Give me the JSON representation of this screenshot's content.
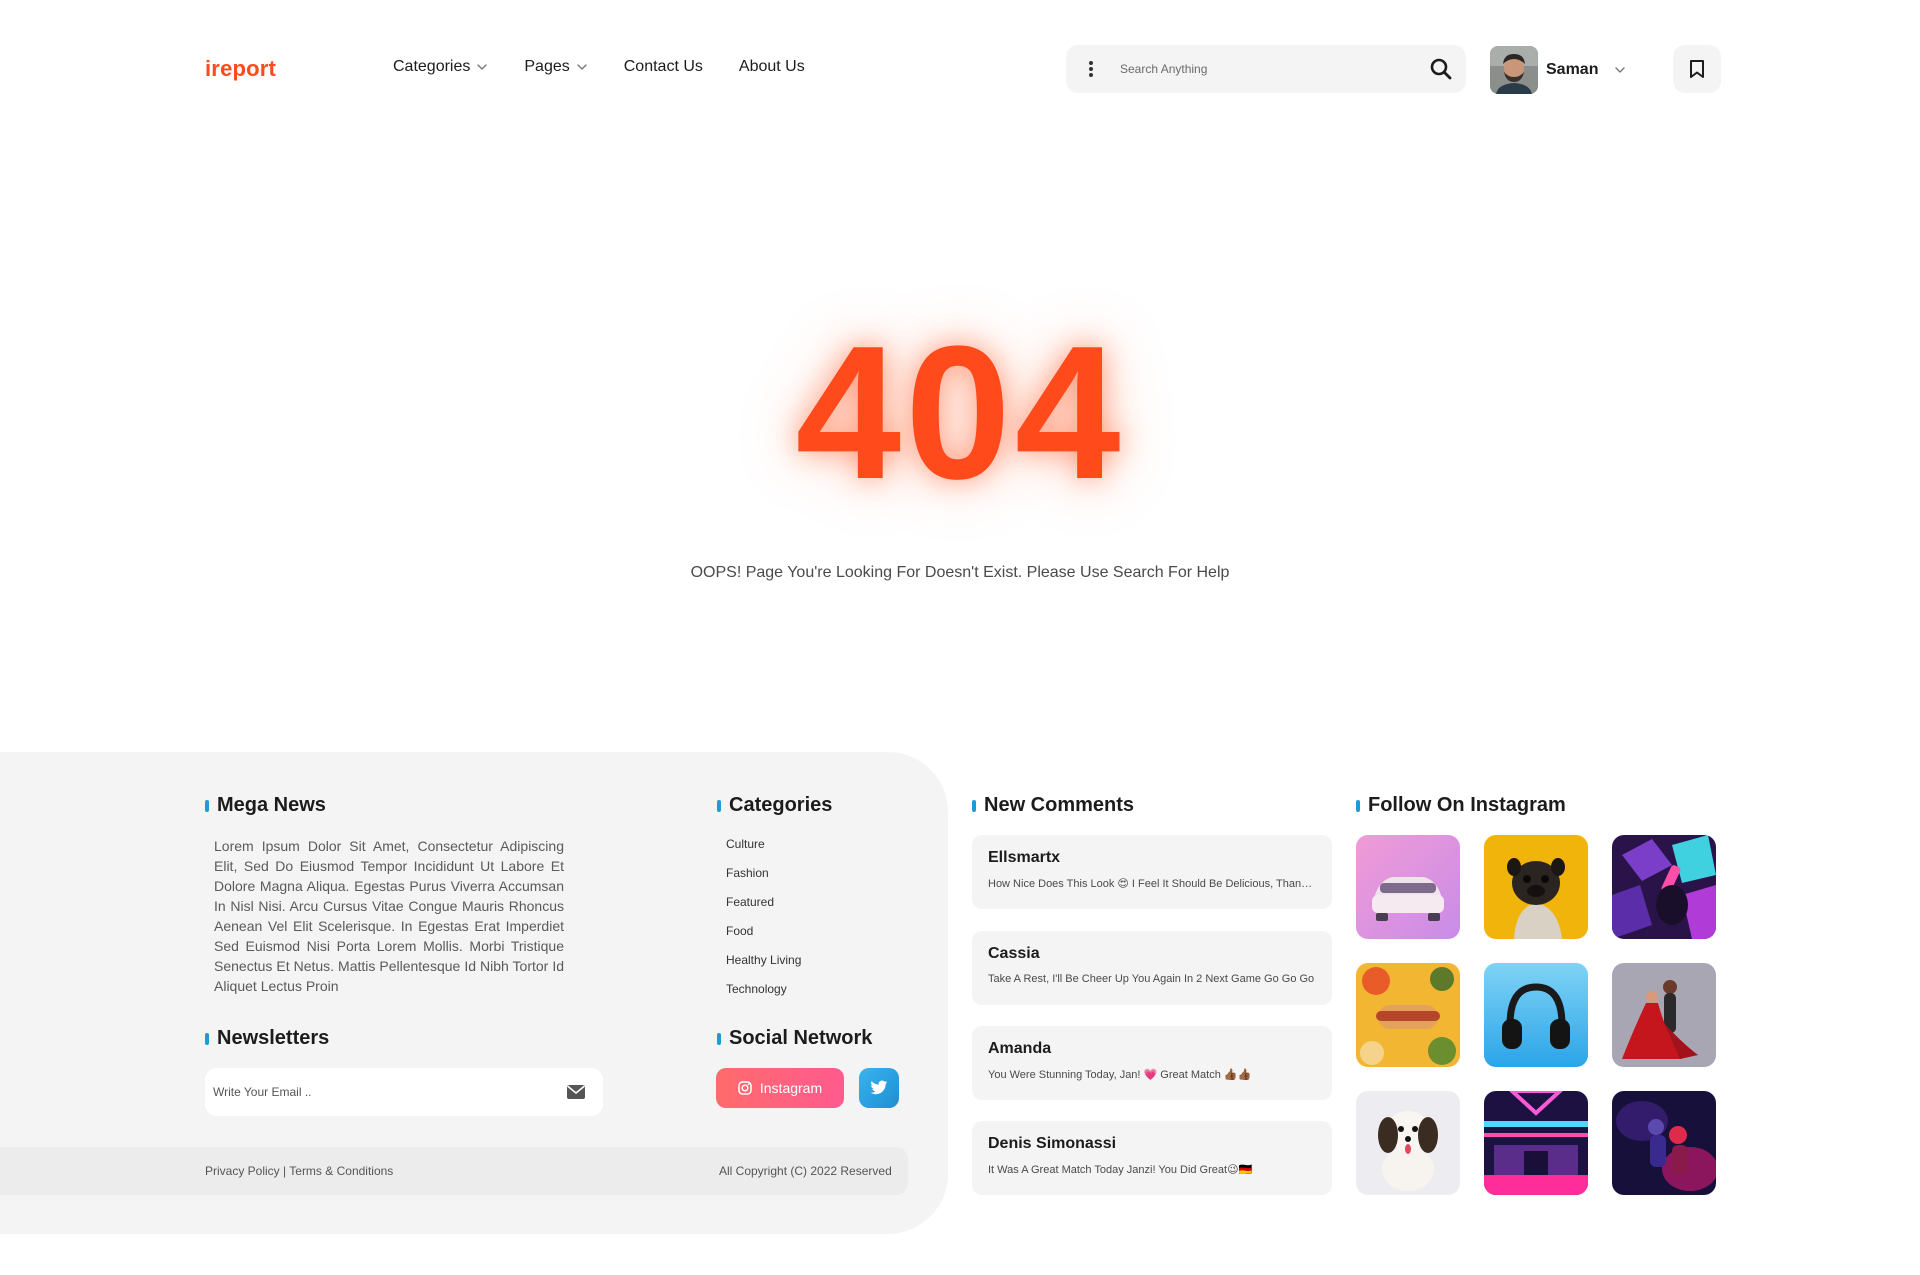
{
  "header": {
    "logo": "ireport",
    "nav": [
      {
        "label": "Categories",
        "has_dropdown": true
      },
      {
        "label": "Pages",
        "has_dropdown": true
      },
      {
        "label": "Contact Us",
        "has_dropdown": false
      },
      {
        "label": "About Us",
        "has_dropdown": false
      }
    ],
    "search": {
      "placeholder": "Search Anything"
    },
    "user": {
      "name": "Saman"
    }
  },
  "error": {
    "code": "404",
    "message": "OOPS! Page You're Looking For Doesn't Exist. Please Use Search For Help"
  },
  "footer": {
    "mega_news": {
      "title": "Mega News",
      "text": "Lorem Ipsum Dolor Sit Amet, Consectetur Adipiscing Elit, Sed Do Eiusmod Tempor Incididunt Ut Labore Et Dolore Magna Aliqua. Egestas Purus Viverra Accumsan In Nisl Nisi. Arcu Cursus Vitae Congue Mauris Rhoncus Aenean Vel Elit Scelerisque. In Egestas Erat Imperdiet Sed Euismod Nisi Porta Lorem Mollis. Morbi Tristique Senectus Et Netus. Mattis Pellentesque Id Nibh Tortor Id Aliquet Lectus Proin"
    },
    "categories": {
      "title": "Categories",
      "items": [
        "Culture",
        "Fashion",
        "Featured",
        "Food",
        "Healthy Living",
        "Technology"
      ]
    },
    "newsletters": {
      "title": "Newsletters",
      "placeholder": "Write Your Email .."
    },
    "social": {
      "title": "Social Network",
      "instagram_label": "Instagram"
    },
    "new_comments": {
      "title": "New Comments",
      "items": [
        {
          "name": "Ellsmartx",
          "text": "How Nice Does This Look 😍 I Feel It Should Be Delicious, Thank You"
        },
        {
          "name": "Cassia",
          "text": "Take A Rest, I'll Be Cheer Up You Again In 2 Next Game Go Go Go"
        },
        {
          "name": "Amanda",
          "text": "You Were Stunning Today, Jan! 💗 Great Match 👍🏾👍🏾"
        },
        {
          "name": "Denis Simonassi",
          "text": "It Was A Great Match Today Janzi! You Did Great😉🇩🇪"
        }
      ]
    },
    "instagram": {
      "title": "Follow On Instagram"
    },
    "bottom": {
      "privacy": "Privacy Policy",
      "separator": " | ",
      "terms": "Terms & Conditions",
      "copyright": "All Copyright (C) 2022 Reserved"
    }
  },
  "colors": {
    "accent": "#ff4a1c",
    "title_bar": "#1e9bd7",
    "panel_bg": "#f4f4f4"
  },
  "icons": [
    "chevron-down-icon",
    "more-vertical-icon",
    "search-icon",
    "bookmark-icon",
    "mail-icon",
    "instagram-icon",
    "twitter-icon"
  ]
}
